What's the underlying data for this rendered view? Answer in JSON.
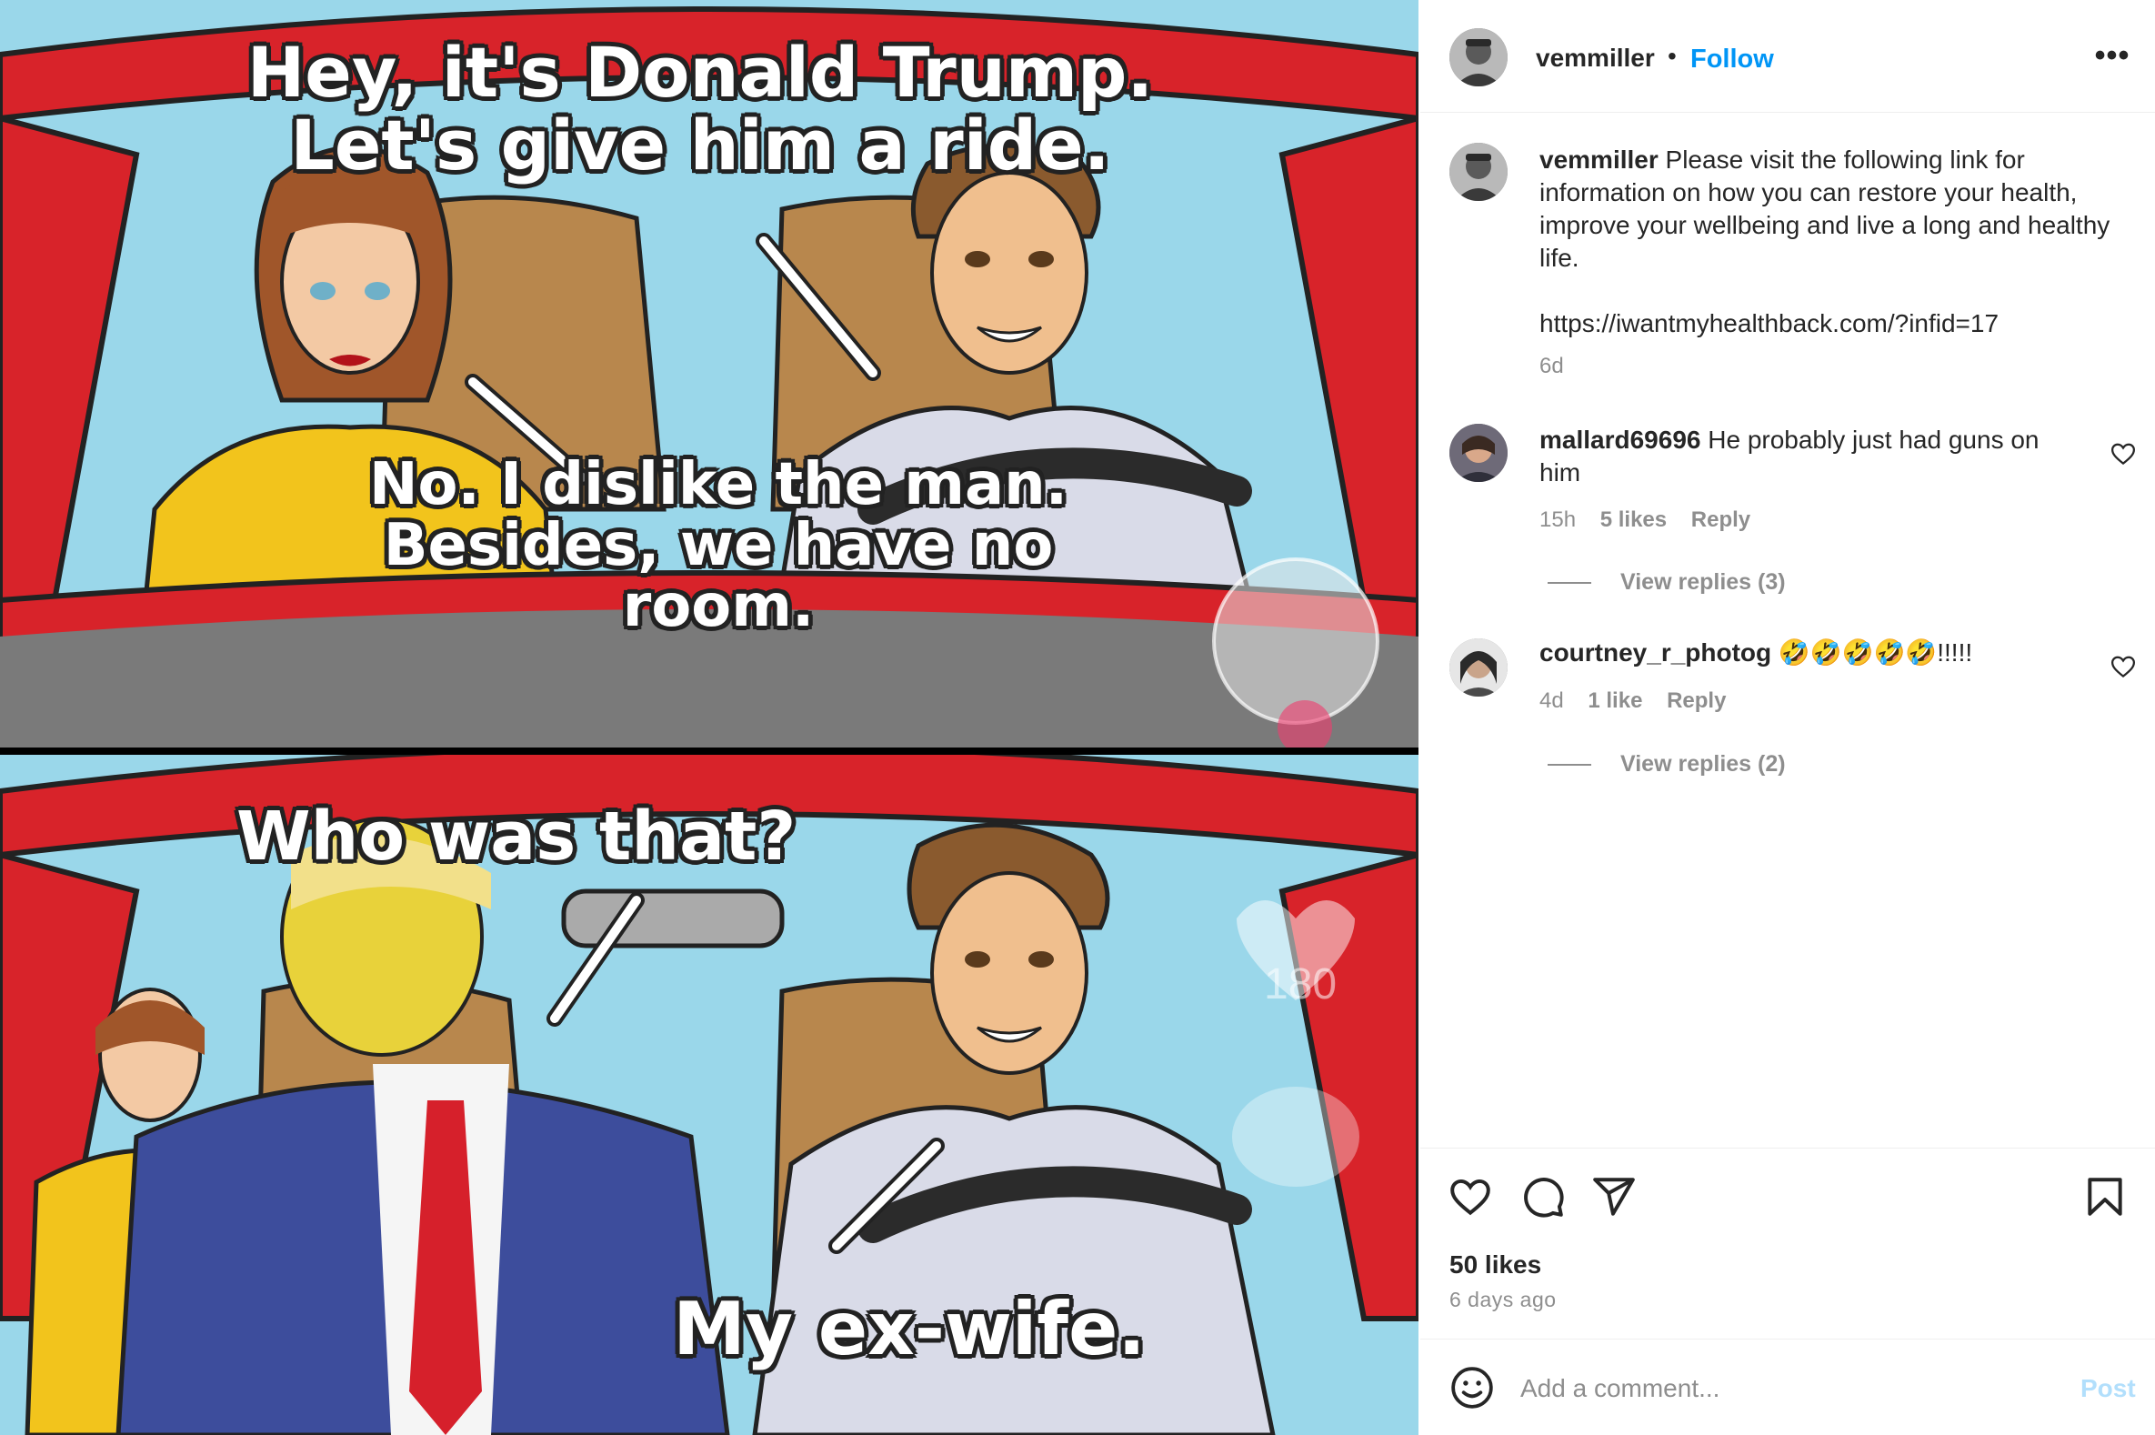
{
  "media": {
    "captions": {
      "top_1": "Hey, it's Donald Trump. Let's give him a ride.",
      "top_2": "No. I dislike the man. Besides, we have no room.",
      "bottom_1": "Who was that?",
      "bottom_2": "My ex-wife."
    },
    "overlay_count": "180"
  },
  "header": {
    "username": "vemmiller",
    "separator": "•",
    "follow_label": "Follow",
    "more_icon": "more-options-icon",
    "more_label": "•••"
  },
  "caption": {
    "username": "vemmiller",
    "text": "Please visit the following link for information on how you can restore your health, improve your wellbeing and live a long and healthy life.",
    "link": "https://iwantmyhealthback.com/?infid=17",
    "time": "6d"
  },
  "comments": [
    {
      "username": "mallard69696",
      "text": "He probably just had guns on him",
      "time": "15h",
      "likes": "5 likes",
      "reply_label": "Reply",
      "view_replies": "View replies (3)"
    },
    {
      "username": "courtney_r_photog",
      "text": "🤣🤣🤣🤣🤣!!!!!",
      "time": "4d",
      "likes": "1 like",
      "reply_label": "Reply",
      "view_replies": "View replies (2)"
    }
  ],
  "actions": {
    "like_icon": "heart-icon",
    "comment_icon": "comment-icon",
    "share_icon": "share-icon",
    "save_icon": "bookmark-icon",
    "likes": "50 likes",
    "posted": "6 days ago"
  },
  "add_comment": {
    "placeholder": "Add a comment...",
    "post_label": "Post",
    "emoji_icon": "emoji-icon"
  },
  "colors": {
    "accent": "#0095f6",
    "muted": "#8e8e8e",
    "text": "#262626",
    "post_disabled": "#b2dffc"
  }
}
